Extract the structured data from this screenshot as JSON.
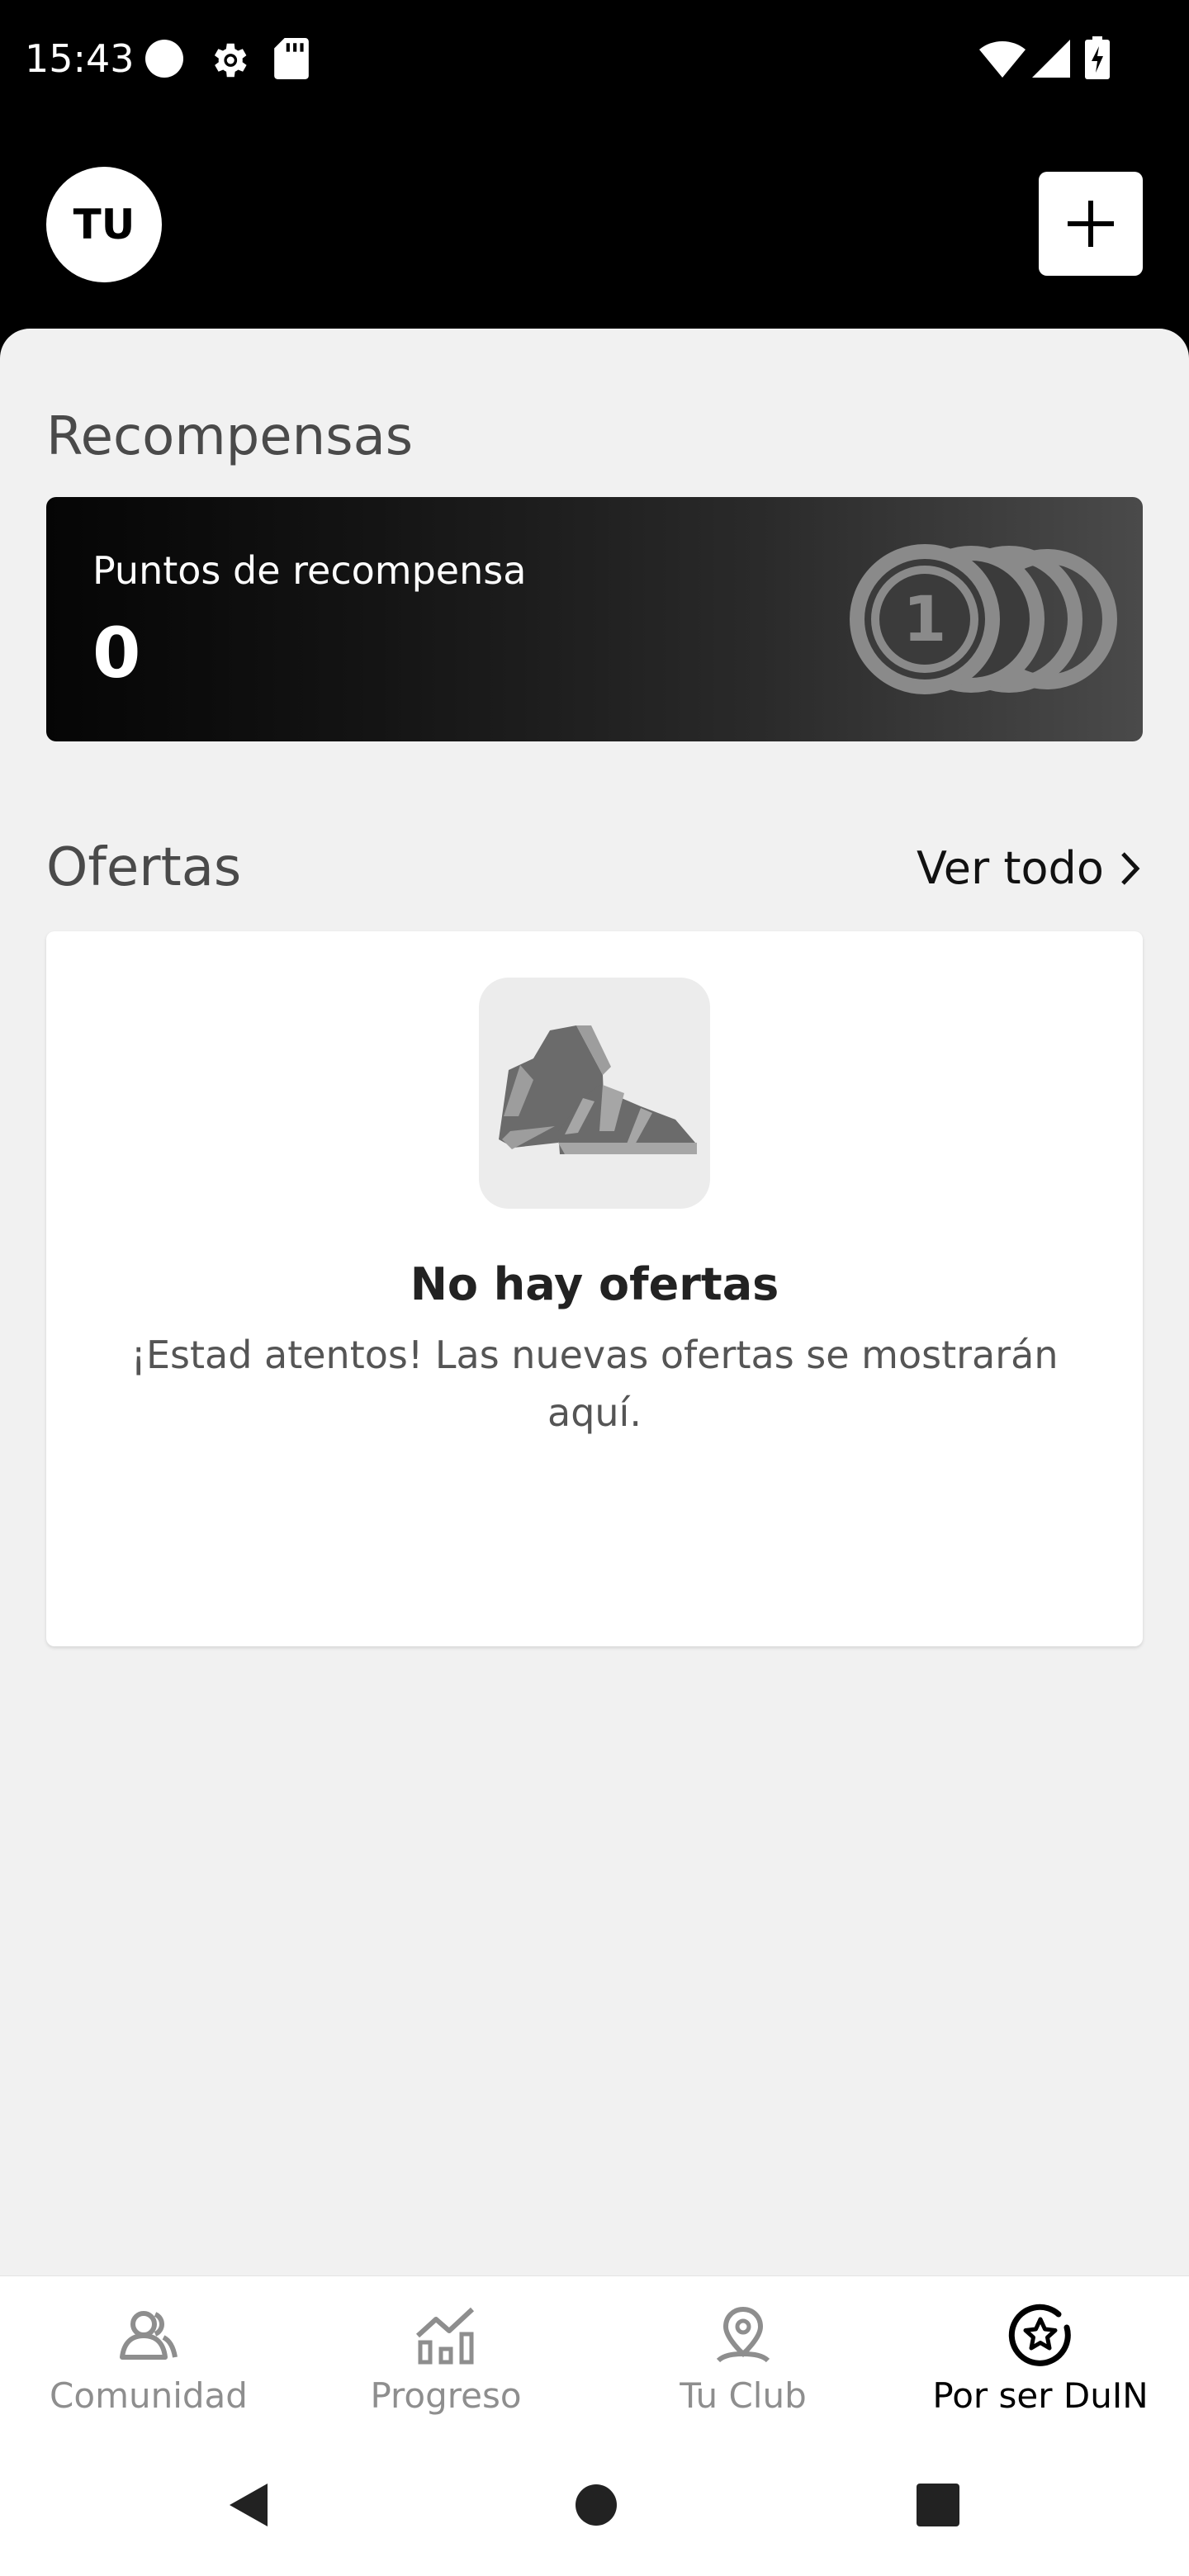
{
  "status_bar": {
    "time": "15:43",
    "icons_left": [
      "circle-icon",
      "gear-icon",
      "sd-card-icon"
    ],
    "icons_right": [
      "wifi-icon",
      "signal-icon",
      "battery-charging-icon"
    ]
  },
  "header": {
    "avatar_initials": "TU",
    "add_icon": "plus-icon"
  },
  "rewards": {
    "section_title": "Recompensas",
    "card_label": "Puntos de recompensa",
    "points": "0",
    "coin_number": "1"
  },
  "offers": {
    "section_title": "Ofertas",
    "see_all_label": "Ver todo",
    "empty_title": "No hay ofertas",
    "empty_text": "¡Estad atentos! Las nuevas ofertas se mostrarán aquí."
  },
  "bottom_nav": {
    "items": [
      {
        "label": "Comunidad",
        "icon": "community-icon",
        "active": false
      },
      {
        "label": "Progreso",
        "icon": "progress-chart-icon",
        "active": false
      },
      {
        "label": "Tu Club",
        "icon": "location-pin-icon",
        "active": false
      },
      {
        "label": "Por ser DuIN",
        "icon": "star-badge-icon",
        "active": true
      }
    ]
  },
  "colors": {
    "background": "#f1f1f1",
    "header": "#000000",
    "active_nav": "#000000",
    "inactive_nav": "#8e8e8e"
  }
}
